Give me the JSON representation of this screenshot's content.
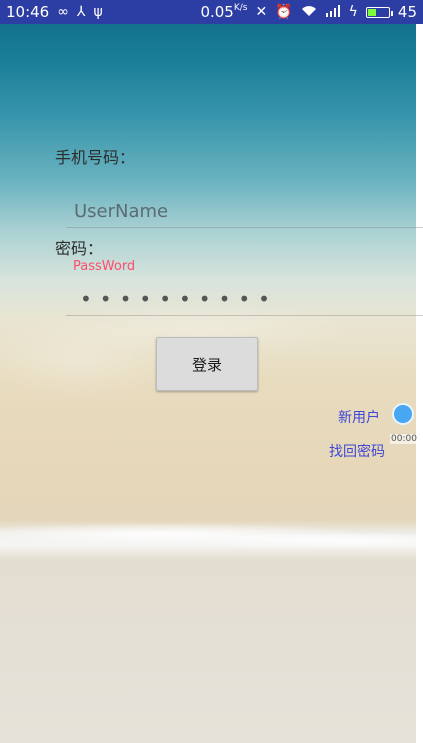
{
  "status_bar": {
    "time": "10:46",
    "net_speed": "0.05",
    "net_unit": "K/s",
    "battery": "45",
    "battery_fill": 0.45,
    "left_icons": [
      "infinity-icon",
      "usb-icon",
      "download-icon"
    ],
    "right_icons": [
      "mute-icon",
      "alarm-icon",
      "wifi-icon",
      "signal-4g-icon",
      "charging-icon",
      "battery-icon"
    ]
  },
  "login": {
    "phone_label": "手机号码：",
    "username_placeholder": "UserName",
    "password_label": "密码：",
    "password_hint": "PassWord",
    "password_value": "••••••••••",
    "login_button": "登录",
    "new_user_link": "新用户",
    "recover_password_link": "找回密码",
    "floating_timer": "00:00"
  },
  "colors": {
    "status_bar": "#2c3ea3",
    "link": "#3f46d6",
    "hint": "#ff4d6a",
    "floating_dot": "#49a6f0"
  }
}
